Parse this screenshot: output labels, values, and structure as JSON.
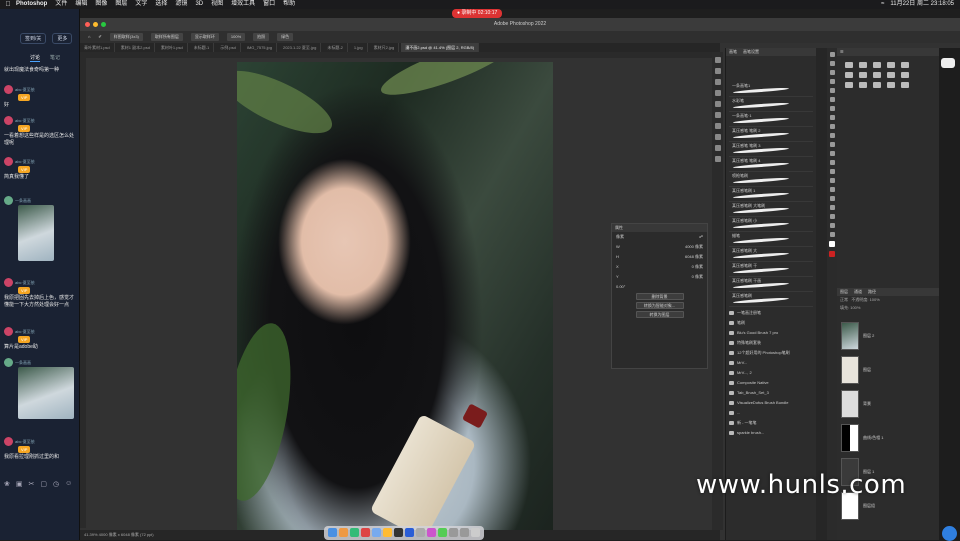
{
  "menubar": {
    "app": "Photoshop",
    "items": [
      "文件",
      "编辑",
      "图像",
      "图层",
      "文字",
      "选择",
      "滤镜",
      "3D",
      "视图",
      "增效工具",
      "窗口",
      "帮助"
    ],
    "clock": "11月22日 周二 23:18:05"
  },
  "recording": {
    "label": "● 录制中 02:10:17"
  },
  "chat": {
    "top_buttons": [
      "签到/关",
      "更多"
    ],
    "tabs": [
      "讨论",
      "笔记"
    ],
    "active_tab": "讨论",
    "messages": [
      {
        "text": "就出现魔法食奇吗第一种"
      },
      {
        "user": "abc·夏至依",
        "badge": "VIP",
        "text": "好"
      },
      {
        "user": "abc·夏至依",
        "badge": "VIP",
        "text": "一看着想这些样是的选区怎么处理呢"
      },
      {
        "user": "abc·夏至依",
        "badge": "VIP",
        "text": "简真我懂了"
      },
      {
        "user": "一条画画",
        "text": ""
      },
      {
        "user": "abc·夏至依",
        "badge": "VIP",
        "text": "我原把固先去掉后上色，感觉才懂能一下大方然处理会好一点"
      },
      {
        "user": "abc·夏至依",
        "badge": "VIP",
        "text": "算片是adobe助"
      },
      {
        "user": "一条画画",
        "text": ""
      },
      {
        "user": "abc·夏至依",
        "badge": "VIP",
        "text": "我原看拉理刚抓过里的和"
      }
    ]
  },
  "photoshop": {
    "window_title": "Adobe Photoshop 2022",
    "options": [
      "样图取样(3x3)",
      "取样所有图层",
      "显示取样环",
      "100%",
      "拍照",
      "绿色"
    ],
    "doc_tabs": [
      "青叶素材1.psd",
      "素材1 副本2.psd",
      "素材叶1.psd",
      "未标题-1",
      "示例.psd",
      "IMG_7575.jpg",
      "2023.1.22 夏至.jpg",
      "未标题-2",
      "1.jpg",
      "素材尺2.jpg",
      "漫不画2.psd @ 41.4% (图层 2, RGB/8)"
    ],
    "active_doc_tab": "漫不画2.psd @ 41.4% (图层 2, RGB/8)",
    "status": "41.39%  4000 像素 x 6048 像素 (72 ppi)",
    "adjust_panel": {
      "title": "属性",
      "row1_label": "像素",
      "w_label": "W",
      "w_value": "4000 像素",
      "h_label": "H",
      "h_value": "6048 像素",
      "x_label": "X",
      "x_value": "0 像素",
      "y_label": "Y",
      "y_value": "0 像素",
      "angle": "0.00°",
      "buttons": [
        "删除背景",
        "转换为智能对象...",
        "转换为图层"
      ]
    },
    "brushes_panel": {
      "tabs": [
        "画笔",
        "画笔设置"
      ],
      "items": [
        "一条画笔1",
        "水彩笔",
        "一条画笔·1",
        "某压感笔 笔刷 2",
        "某压感笔 笔刷 3",
        "某压感笔 笔刷 4",
        "喷枪笔刷",
        "某压感笔刷 1",
        "某压感笔刷 大笔刷",
        "某压感笔刷 小",
        "蜡笔",
        "某压感笔刷 大",
        "某压感笔刷 干",
        "某压感笔刷 干画",
        "某压感笔刷"
      ],
      "folders": [
        "一笔画注册笔",
        "笔刷",
        "Blu's Good Brush 7 pro",
        "特殊笔刷套装",
        "12个超好用的 Photoshop笔刷",
        "MrV...",
        "MrV..., 2",
        "Composite Native",
        "Tab_Brush_Set_3",
        "VisualizeDofus Brush Bundle",
        "...",
        "新 - 一笔笔",
        "sparkle brush..."
      ]
    },
    "layers_panel": {
      "tabs": [
        "图层",
        "通道",
        "路径"
      ],
      "blend_mode": "正常",
      "opacity": "不透明度: 100%",
      "fill": "填充: 100%",
      "layers": [
        "图层 2",
        "图层",
        "背景",
        "曲线/色相 1",
        "图层 1",
        "图层组"
      ]
    }
  },
  "watermark": "www.hunls.com"
}
